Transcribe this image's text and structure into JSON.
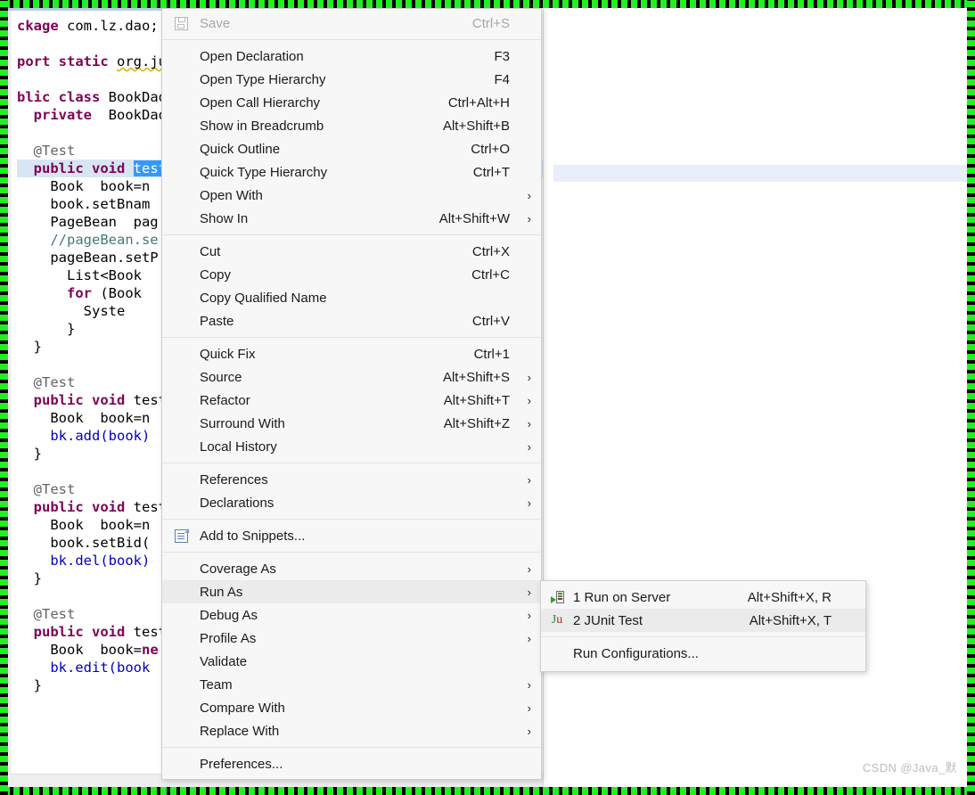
{
  "editor": {
    "code_lines": [
      {
        "indent": 0,
        "segments": [
          {
            "t": "ckage",
            "c": "kw"
          },
          {
            "t": " com.lz.dao;",
            "c": ""
          }
        ]
      },
      {
        "indent": 0,
        "segments": []
      },
      {
        "indent": 0,
        "segments": [
          {
            "t": "port static",
            "c": "kw"
          },
          {
            "t": " ",
            "c": ""
          },
          {
            "t": "org.jur",
            "c": "squiggle"
          }
        ]
      },
      {
        "indent": 0,
        "segments": []
      },
      {
        "indent": 0,
        "segments": [
          {
            "t": "blic class",
            "c": "kw"
          },
          {
            "t": " BookDaoT",
            "c": ""
          }
        ]
      },
      {
        "indent": 1,
        "segments": [
          {
            "t": "private",
            "c": "kw"
          },
          {
            "t": "  BookDao",
            "c": ""
          }
        ]
      },
      {
        "indent": 0,
        "segments": []
      },
      {
        "indent": 1,
        "segments": [
          {
            "t": "@Test",
            "c": "ann"
          }
        ]
      },
      {
        "indent": 1,
        "selected": true,
        "segments": [
          {
            "t": "public void",
            "c": "kw"
          },
          {
            "t": " ",
            "c": ""
          },
          {
            "t": "testL",
            "c": "sel-text"
          }
        ]
      },
      {
        "indent": 2,
        "segments": [
          {
            "t": "Book  book=n",
            "c": ""
          }
        ]
      },
      {
        "indent": 2,
        "segments": [
          {
            "t": "book.setBnam",
            "c": ""
          }
        ]
      },
      {
        "indent": 2,
        "segments": [
          {
            "t": "PageBean  pag",
            "c": ""
          }
        ]
      },
      {
        "indent": 2,
        "segments": [
          {
            "t": "//pageBean.se",
            "c": "cmt"
          }
        ]
      },
      {
        "indent": 2,
        "segments": [
          {
            "t": "pageBean.setP",
            "c": ""
          }
        ]
      },
      {
        "indent": 3,
        "segments": [
          {
            "t": "List<Book",
            "c": ""
          }
        ]
      },
      {
        "indent": 3,
        "segments": [
          {
            "t": "for",
            "c": "kw"
          },
          {
            "t": " (Book",
            "c": ""
          }
        ]
      },
      {
        "indent": 4,
        "segments": [
          {
            "t": "Syste",
            "c": ""
          }
        ]
      },
      {
        "indent": 3,
        "segments": [
          {
            "t": "}",
            "c": ""
          }
        ]
      },
      {
        "indent": 1,
        "segments": [
          {
            "t": "}",
            "c": ""
          }
        ]
      },
      {
        "indent": 0,
        "segments": []
      },
      {
        "indent": 1,
        "segments": [
          {
            "t": "@Test",
            "c": "ann"
          }
        ]
      },
      {
        "indent": 1,
        "segments": [
          {
            "t": "public void",
            "c": "kw"
          },
          {
            "t": " testA",
            "c": ""
          }
        ]
      },
      {
        "indent": 2,
        "segments": [
          {
            "t": "Book  book=n",
            "c": ""
          }
        ]
      },
      {
        "indent": 2,
        "segments": [
          {
            "t": "bk.add(book)",
            "c": "fld"
          }
        ]
      },
      {
        "indent": 1,
        "segments": [
          {
            "t": "}",
            "c": ""
          }
        ]
      },
      {
        "indent": 0,
        "segments": []
      },
      {
        "indent": 1,
        "segments": [
          {
            "t": "@Test",
            "c": "ann"
          }
        ]
      },
      {
        "indent": 1,
        "segments": [
          {
            "t": "public void",
            "c": "kw"
          },
          {
            "t": " testD",
            "c": ""
          }
        ]
      },
      {
        "indent": 2,
        "segments": [
          {
            "t": "Book  book=n",
            "c": ""
          }
        ]
      },
      {
        "indent": 2,
        "segments": [
          {
            "t": "book.setBid(",
            "c": ""
          }
        ]
      },
      {
        "indent": 2,
        "segments": [
          {
            "t": "bk.del(book)",
            "c": "fld"
          }
        ]
      },
      {
        "indent": 1,
        "segments": [
          {
            "t": "}",
            "c": ""
          }
        ]
      },
      {
        "indent": 0,
        "segments": []
      },
      {
        "indent": 1,
        "segments": [
          {
            "t": "@Test",
            "c": "ann"
          }
        ]
      },
      {
        "indent": 1,
        "segments": [
          {
            "t": "public void",
            "c": "kw"
          },
          {
            "t": " testE",
            "c": ""
          }
        ]
      },
      {
        "indent": 2,
        "segments": [
          {
            "t": "Book  book=",
            "c": ""
          },
          {
            "t": "ne",
            "c": "kw"
          }
        ]
      },
      {
        "indent": 2,
        "segments": [
          {
            "t": "bk.edit(book",
            "c": "fld"
          }
        ]
      },
      {
        "indent": 1,
        "segments": [
          {
            "t": "}",
            "c": ""
          }
        ]
      }
    ]
  },
  "context_menu": {
    "groups": [
      {
        "items": [
          {
            "label": "Save",
            "accel": "Ctrl+S",
            "icon": "save-icon",
            "disabled": true,
            "submenu": false
          }
        ]
      },
      {
        "items": [
          {
            "label": "Open Declaration",
            "accel": "F3",
            "submenu": false
          },
          {
            "label": "Open Type Hierarchy",
            "accel": "F4",
            "submenu": false
          },
          {
            "label": "Open Call Hierarchy",
            "accel": "Ctrl+Alt+H",
            "submenu": false
          },
          {
            "label": "Show in Breadcrumb",
            "accel": "Alt+Shift+B",
            "submenu": false
          },
          {
            "label": "Quick Outline",
            "accel": "Ctrl+O",
            "submenu": false
          },
          {
            "label": "Quick Type Hierarchy",
            "accel": "Ctrl+T",
            "submenu": false
          },
          {
            "label": "Open With",
            "accel": "",
            "submenu": true
          },
          {
            "label": "Show In",
            "accel": "Alt+Shift+W",
            "submenu": true
          }
        ]
      },
      {
        "items": [
          {
            "label": "Cut",
            "accel": "Ctrl+X",
            "submenu": false
          },
          {
            "label": "Copy",
            "accel": "Ctrl+C",
            "submenu": false
          },
          {
            "label": "Copy Qualified Name",
            "accel": "",
            "submenu": false
          },
          {
            "label": "Paste",
            "accel": "Ctrl+V",
            "submenu": false
          }
        ]
      },
      {
        "items": [
          {
            "label": "Quick Fix",
            "accel": "Ctrl+1",
            "submenu": false
          },
          {
            "label": "Source",
            "accel": "Alt+Shift+S",
            "submenu": true
          },
          {
            "label": "Refactor",
            "accel": "Alt+Shift+T",
            "submenu": true
          },
          {
            "label": "Surround With",
            "accel": "Alt+Shift+Z",
            "submenu": true
          },
          {
            "label": "Local History",
            "accel": "",
            "submenu": true
          }
        ]
      },
      {
        "items": [
          {
            "label": "References",
            "accel": "",
            "submenu": true
          },
          {
            "label": "Declarations",
            "accel": "",
            "submenu": true
          }
        ]
      },
      {
        "items": [
          {
            "label": "Add to Snippets...",
            "accel": "",
            "icon": "snippet-icon",
            "submenu": false
          }
        ]
      },
      {
        "items": [
          {
            "label": "Coverage As",
            "accel": "",
            "submenu": true
          },
          {
            "label": "Run As",
            "accel": "",
            "submenu": true,
            "highlighted": true
          },
          {
            "label": "Debug As",
            "accel": "",
            "submenu": true
          },
          {
            "label": "Profile As",
            "accel": "",
            "submenu": true
          },
          {
            "label": "Validate",
            "accel": "",
            "submenu": false
          },
          {
            "label": "Team",
            "accel": "",
            "submenu": true
          },
          {
            "label": "Compare With",
            "accel": "",
            "submenu": true
          },
          {
            "label": "Replace With",
            "accel": "",
            "submenu": true
          }
        ]
      },
      {
        "items": [
          {
            "label": "Preferences...",
            "accel": "",
            "submenu": false
          }
        ]
      }
    ]
  },
  "run_as_submenu": {
    "groups": [
      {
        "items": [
          {
            "label": "1 Run on Server",
            "accel": "Alt+Shift+X, R",
            "icon": "run-on-server-icon",
            "highlighted": false
          },
          {
            "label": "2 JUnit Test",
            "accel": "Alt+Shift+X, T",
            "icon": "junit-icon",
            "highlighted": true
          }
        ]
      },
      {
        "items": [
          {
            "label": "Run Configurations...",
            "accel": "",
            "icon": "",
            "highlighted": false
          }
        ]
      }
    ]
  },
  "watermark": {
    "text": "CSDN @Java_默"
  },
  "colors": {
    "selection_border": "#22f022",
    "menu_bg": "#f7f7f7",
    "menu_highlight": "#ebebeb",
    "code_keyword": "#7f0055",
    "code_comment": "#3f7f5f",
    "code_annotation": "#646464",
    "code_field": "#0000c0",
    "text_selection": "#3399ff",
    "line_highlight": "#d8e6f4"
  }
}
